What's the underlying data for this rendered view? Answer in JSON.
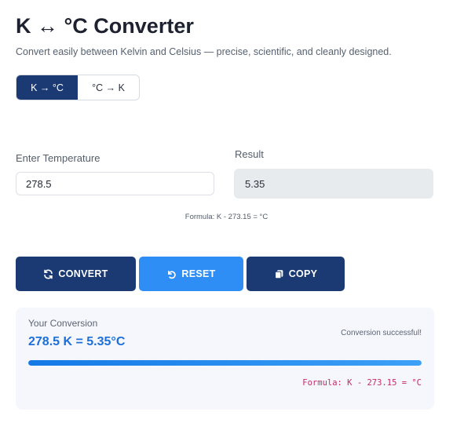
{
  "header": {
    "title": "K ↔ °C Converter",
    "subtitle": "Convert easily between Kelvin and Celsius — precise, scientific, and cleanly designed."
  },
  "mode_toggle": {
    "options": [
      "K → °C",
      "°C → K"
    ],
    "selected": "K → °C"
  },
  "input": {
    "label": "Enter Temperature",
    "value": "278.5"
  },
  "result": {
    "label": "Result",
    "value": "5.35"
  },
  "formula_hint": "Formula: K - 273.15 = °C",
  "buttons": {
    "convert": {
      "label": "CONVERT",
      "icon": "refresh-icon"
    },
    "reset": {
      "label": "RESET",
      "icon": "undo-icon"
    },
    "copy": {
      "label": "COPY",
      "icon": "copy-icon"
    }
  },
  "conversion_card": {
    "heading": "Your Conversion",
    "value": "278.5 K = 5.35°C",
    "status": "Conversion successful!",
    "progress": 1.0,
    "formula": "Formula: K - 273.15 = °C"
  },
  "colors": {
    "primary": "#1b3a73",
    "accent": "#2f8ef5",
    "result_text": "#1c6fd9",
    "formula_mono": "#c42a6a"
  }
}
